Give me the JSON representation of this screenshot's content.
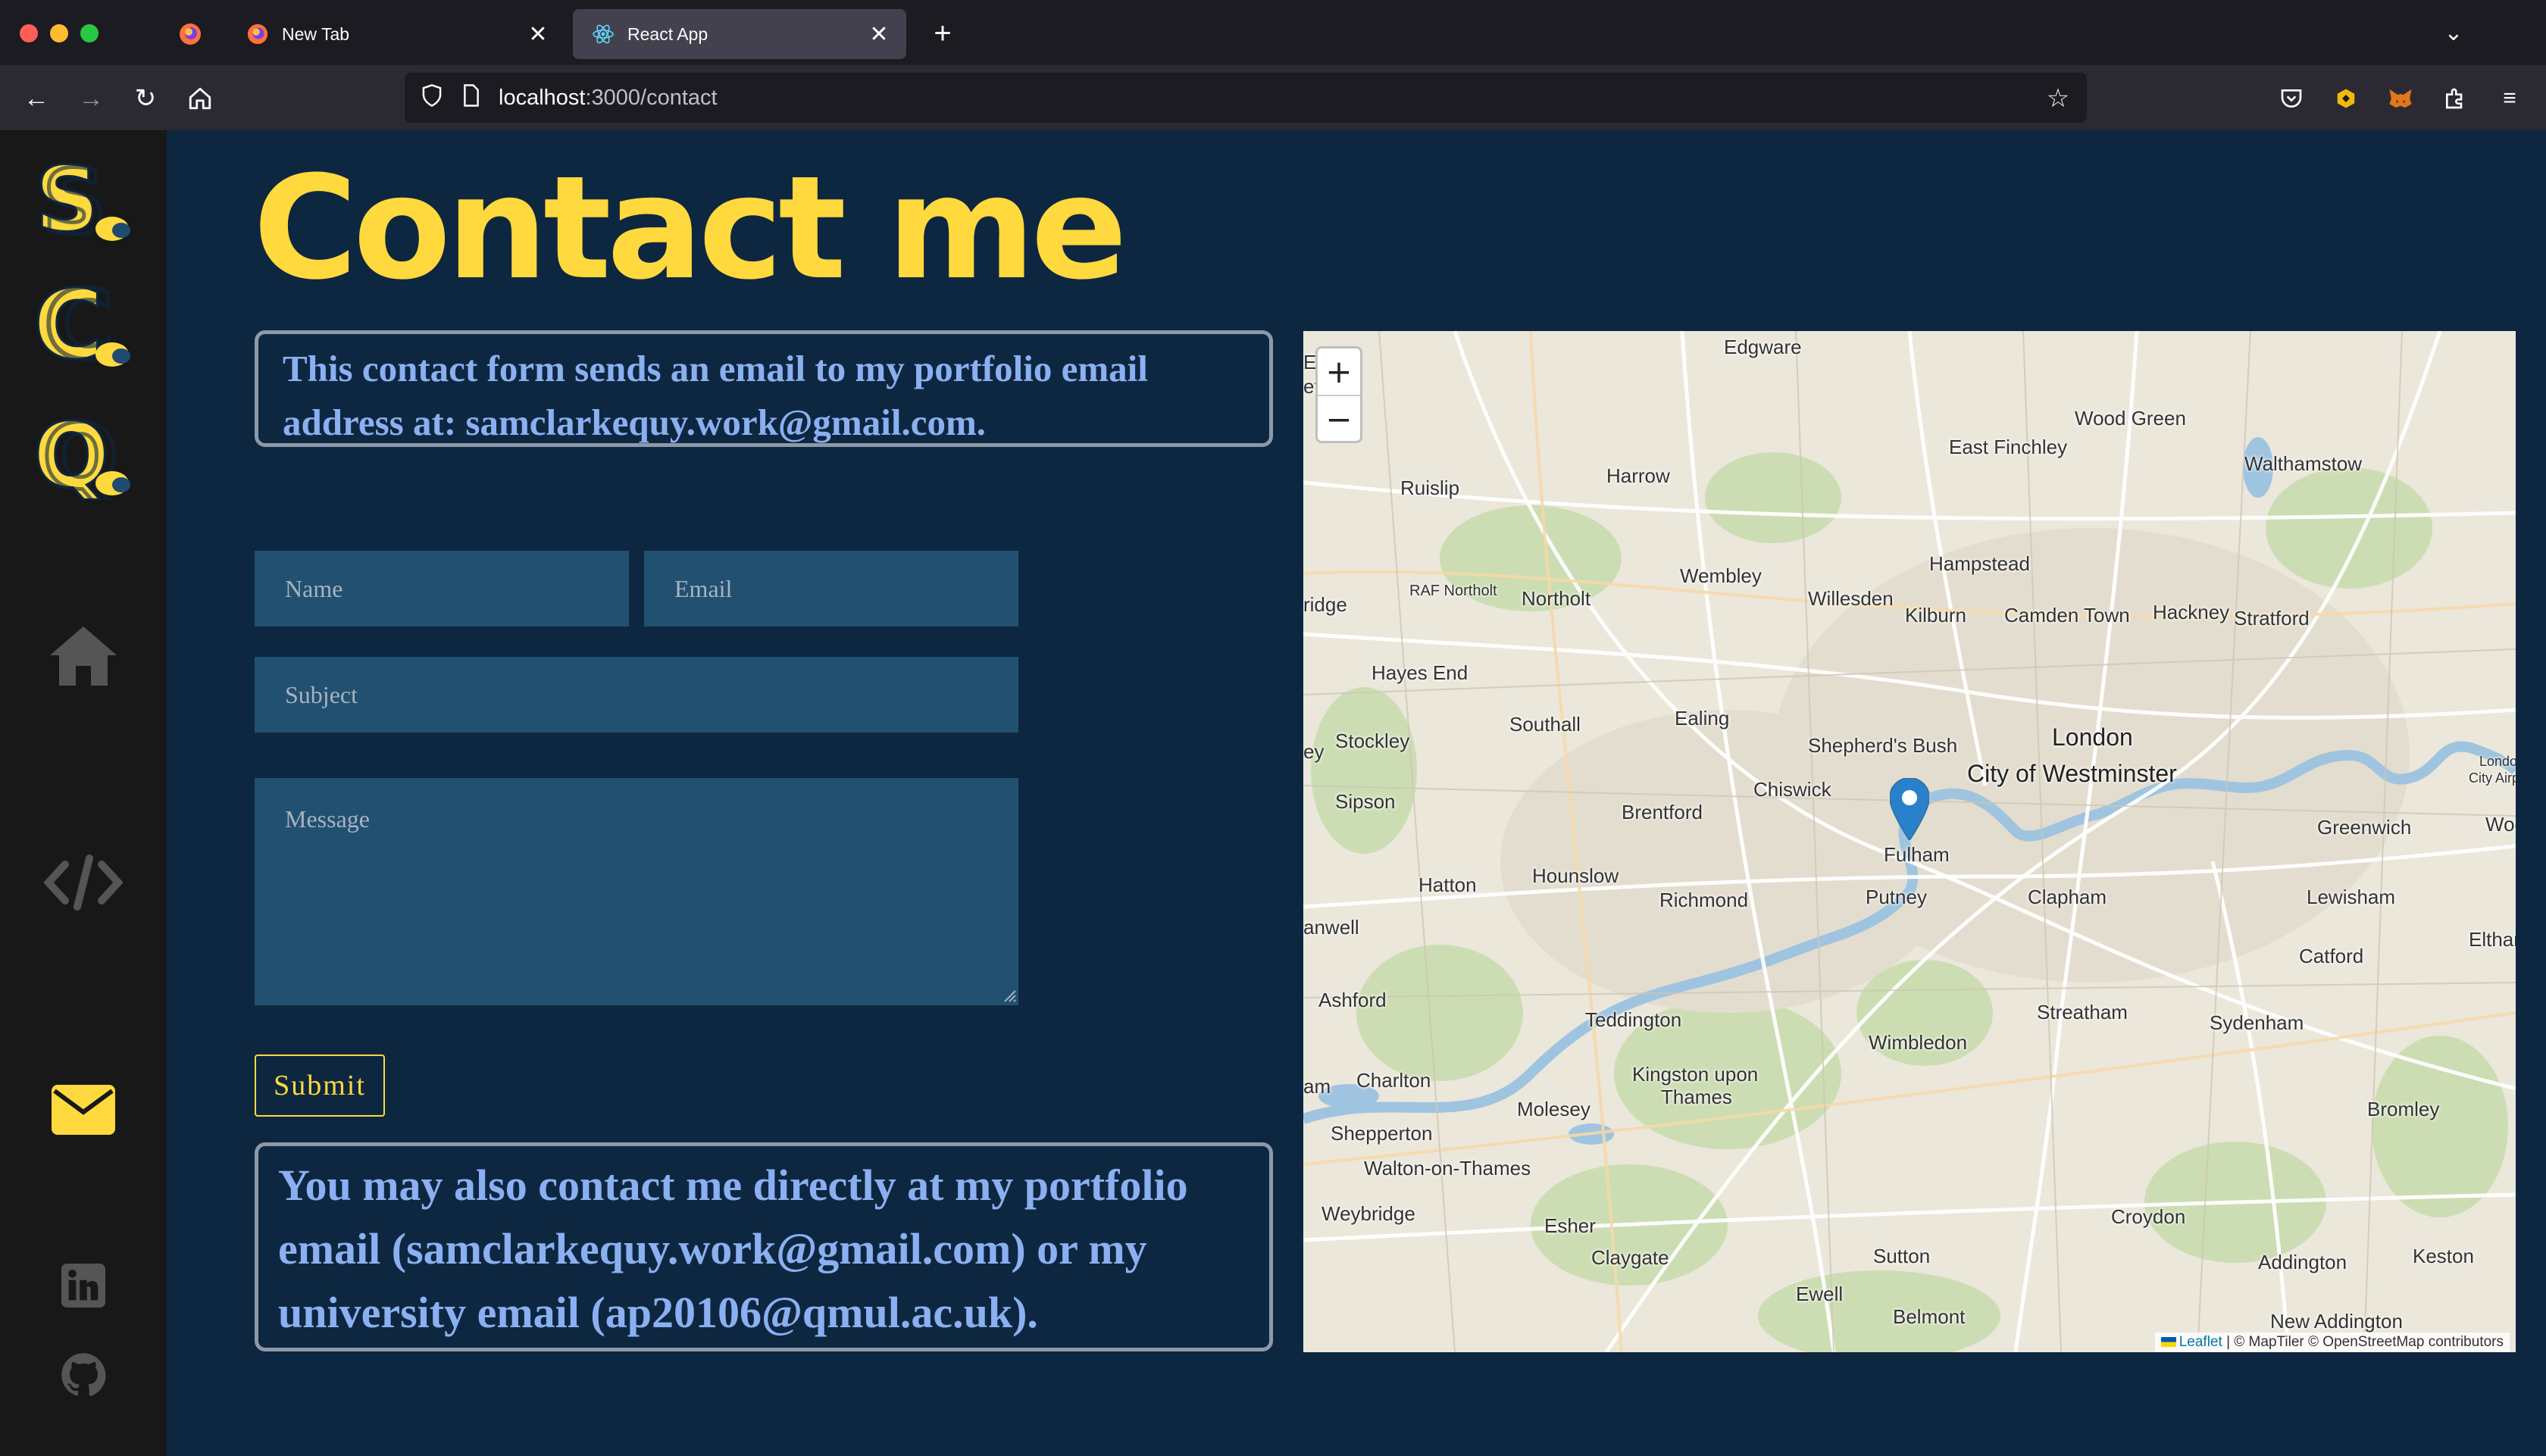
{
  "browser": {
    "tabs": [
      {
        "label": "New Tab",
        "active": false
      },
      {
        "label": "React App",
        "active": true
      }
    ],
    "url_host": "localhost",
    "url_path": ":3000/contact"
  },
  "sidebar": {
    "logos": [
      {
        "letter": "S",
        "name": "logo-s"
      },
      {
        "letter": "C",
        "name": "logo-c"
      },
      {
        "letter": "Q",
        "name": "logo-q"
      }
    ],
    "nav": [
      {
        "icon": "home-icon",
        "active": false
      },
      {
        "icon": "code-icon",
        "active": false
      },
      {
        "icon": "envelope-icon",
        "active": true
      }
    ],
    "social": [
      "linkedin-icon",
      "github-icon"
    ]
  },
  "page": {
    "title": "Contact me",
    "notice_top": "This contact form sends an email to my portfolio email address at: samclarkequy.work@gmail.com.",
    "notice_bottom": "You may also contact me directly at my portfolio email (samclarkequy.work@gmail.com) or my university email (ap20106@qmul.ac.uk)."
  },
  "form": {
    "name_placeholder": "Name",
    "email_placeholder": "Email",
    "subject_placeholder": "Subject",
    "message_placeholder": "Message",
    "submit_label": "Submit"
  },
  "map": {
    "zoom_in": "+",
    "zoom_out": "−",
    "marker_location": "Fulham",
    "attribution_leaflet": "Leaflet",
    "attribution_rest": "| © MapTiler © OpenStreetMap contributors",
    "labels": [
      "Edgware",
      "Wood Green",
      "East Finchley",
      "Harrow",
      "Walthamstow",
      "Ruislip",
      "Hampstead",
      "Wembley",
      "Willesden",
      "Kilburn",
      "Camden Town",
      "Hackney",
      "Stratford",
      "RAF Northolt",
      "Northolt",
      "Hayes End",
      "Southall",
      "Ealing",
      "Stockley",
      "Shepherd's Bush",
      "London",
      "City of Westminster",
      "Chiswick",
      "Sipson",
      "Brentford",
      "Fulham",
      "Greenwich",
      "Hatton",
      "Hounslow",
      "Richmond",
      "Putney",
      "Clapham",
      "Lewisham",
      "Catford",
      "Ashford",
      "Teddington",
      "Streatham",
      "Sydenham",
      "Wimbledon",
      "Charlton",
      "Kingston upon",
      "Thames",
      "Molesey",
      "Shepperton",
      "Walton-on-Thames",
      "Bromley",
      "Weybridge",
      "Esher",
      "Croydon",
      "Claygate",
      "Sutton",
      "Addington",
      "Keston",
      "Ewell",
      "Belmont",
      "New Addington",
      "Wool",
      "Eltham",
      "London",
      "City Airp",
      "ridge",
      "anwell",
      "am",
      "En",
      "ef",
      "ey"
    ]
  }
}
